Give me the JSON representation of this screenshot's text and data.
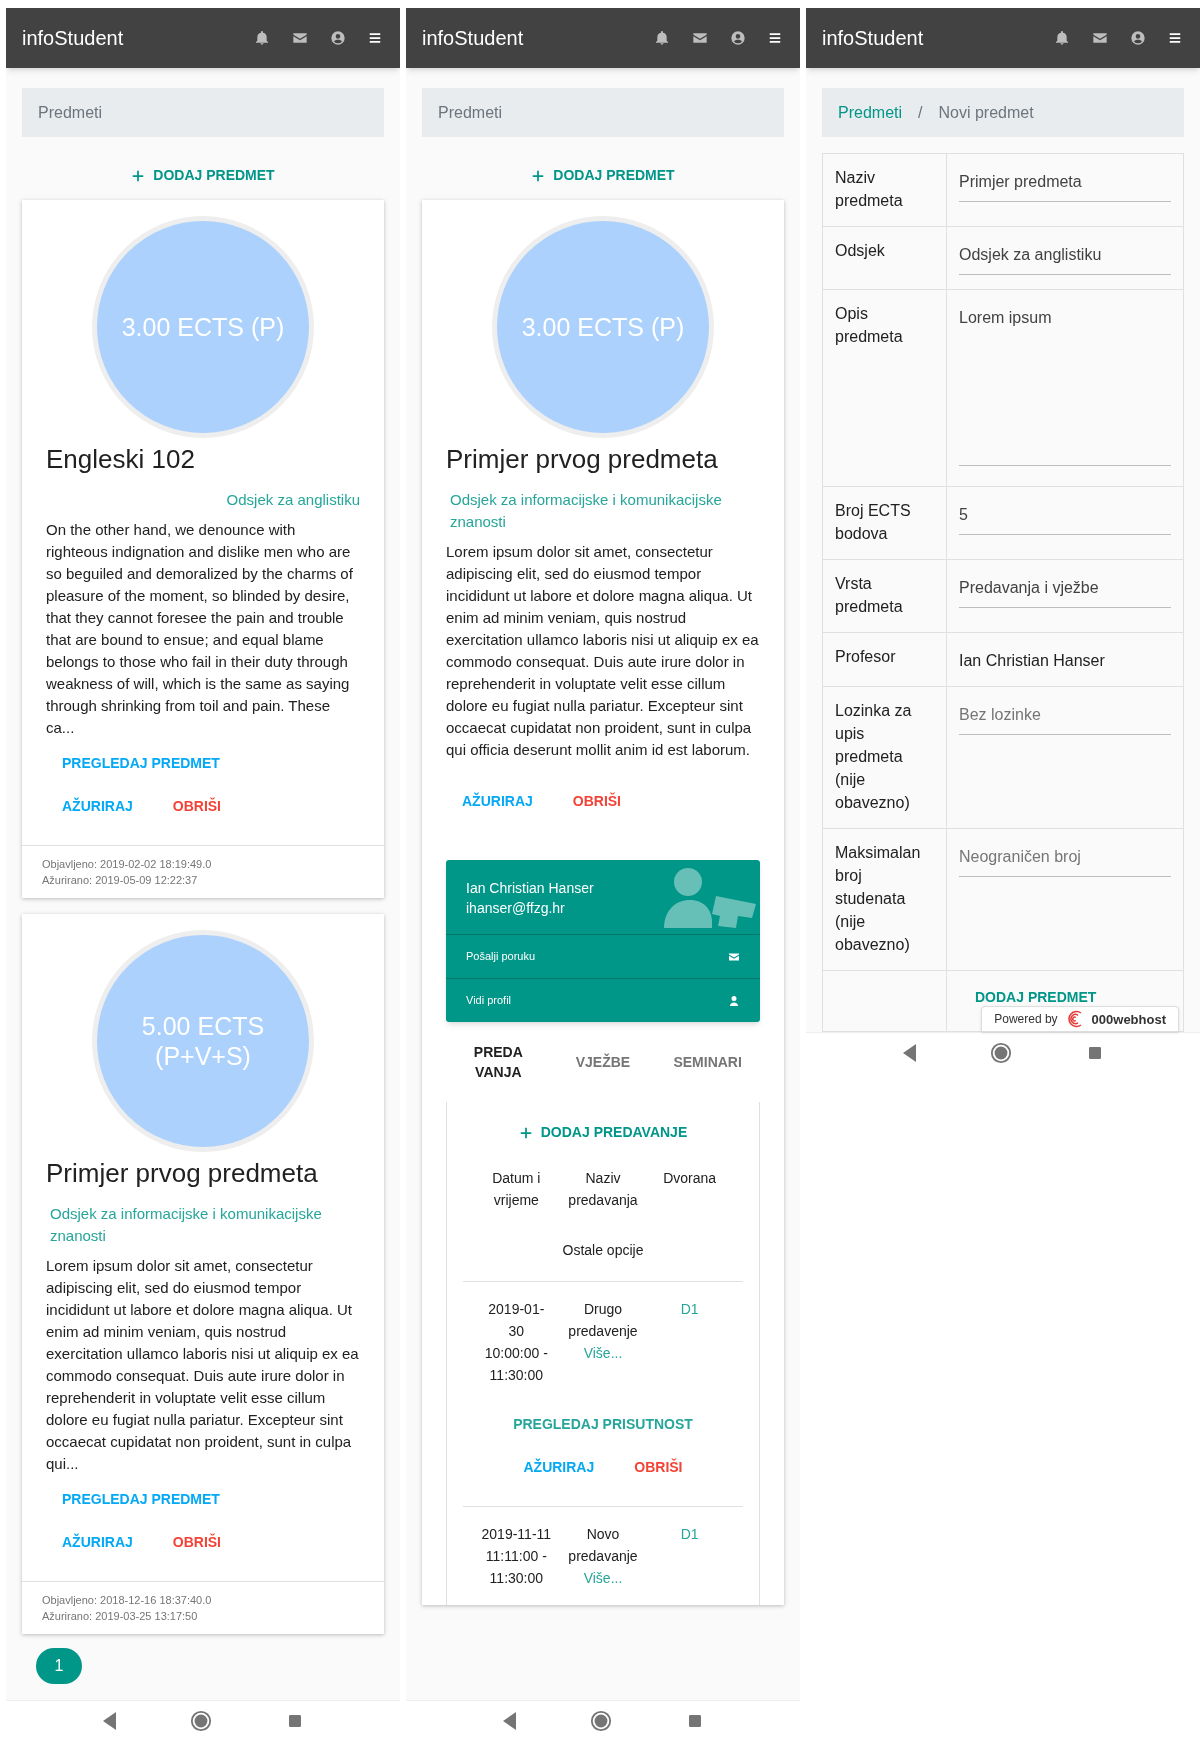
{
  "screens": [
    {
      "kind": "list",
      "app_title": "infoStudent",
      "breadcrumb": [
        {
          "label": "Predmeti",
          "link": false
        }
      ],
      "add_button": "DODAJ PREDMET",
      "courses": [
        {
          "ects": "3.00 ECTS (P)",
          "title": "Engleski 102",
          "department": "Odsjek za anglistiku",
          "department_right_aligned": true,
          "description": "On the other hand, we denounce with righteous indignation and dislike men who are so beguiled and demoralized by the charms of pleasure of the moment, so blinded by desire, that they cannot foresee the pain and trouble that are bound to ensue; and equal blame belongs to those who fail in their duty through weakness of will, which is the same as saying through shrinking from toil and pain. These ca...",
          "view_button": "PREGLEDAJ PREDMET",
          "update_button": "AŽURIRAJ",
          "delete_button": "OBRIŠI",
          "published": "Objavljeno: 2019-02-02 18:19:49.0",
          "updated": "Ažurirano: 2019-05-09 12:22:37"
        },
        {
          "ects": "5.00 ECTS (P+V+S)",
          "title": "Primjer prvog predmeta",
          "department": "Odsjek za informacijske i komunikacijske znanosti",
          "department_right_aligned": false,
          "description": "Lorem ipsum dolor sit amet, consectetur adipiscing elit, sed do eiusmod tempor incididunt ut labore et dolore magna aliqua. Ut enim ad minim veniam, quis nostrud exercitation ullamco laboris nisi ut aliquip ex ea commodo consequat. Duis aute irure dolor in reprehenderit in voluptate velit esse cillum dolore eu fugiat nulla pariatur. Excepteur sint occaecat cupidatat non proident, sunt in culpa qui...",
          "view_button": "PREGLEDAJ PREDMET",
          "update_button": "AŽURIRAJ",
          "delete_button": "OBRIŠI",
          "published": "Objavljeno: 2018-12-16 18:37:40.0",
          "updated": "Ažurirano: 2019-03-25 13:17:50"
        }
      ],
      "pagination": [
        {
          "label": "1",
          "selected": true
        }
      ]
    },
    {
      "kind": "detail",
      "app_title": "infoStudent",
      "breadcrumb": [
        {
          "label": "Predmeti",
          "link": false
        }
      ],
      "add_button": "DODAJ PREDMET",
      "course": {
        "ects": "3.00 ECTS (P)",
        "title": "Primjer prvog predmeta",
        "department": "Odsjek za informacijske i komunikacijske znanosti",
        "department_right_aligned": false,
        "description": "Lorem ipsum dolor sit amet, consectetur adipiscing elit, sed do eiusmod tempor incididunt ut labore et dolore magna aliqua. Ut enim ad minim veniam, quis nostrud exercitation ullamco laboris nisi ut aliquip ex ea commodo consequat. Duis aute irure dolor in reprehenderit in voluptate velit esse cillum dolore eu fugiat nulla pariatur. Excepteur sint occaecat cupidatat non proident, sunt in culpa qui officia deserunt mollit anim id est laborum.",
        "update_button": "AŽURIRAJ",
        "delete_button": "OBRIŠI"
      },
      "professor": {
        "name": "Ian Christian Hanser",
        "email": "ihanser@ffzg.hr",
        "actions": [
          {
            "label": "Pošalji poruku",
            "kind": "mail"
          },
          {
            "label": "Vidi profil",
            "kind": "user"
          }
        ]
      },
      "tabs": [
        {
          "label": "PREDAVANJA",
          "selected": true
        },
        {
          "label": "VJEŽBE",
          "selected": false
        },
        {
          "label": "SEMINARI",
          "selected": false
        }
      ],
      "add_lecture": "DODAJ PREDAVANJE",
      "columns": [
        "Datum i vrijeme",
        "Naziv predavanja",
        "Dvorana",
        "Ostale opcije"
      ],
      "lectures": [
        {
          "datetime": "2019-01-30 10:00:00 - 11:30:00",
          "name": "Drugo predavenje",
          "more": "Više...",
          "room": "D1",
          "attendance_button": "PREGLEDAJ PRISUTNOST",
          "update_button": "AŽURIRAJ",
          "delete_button": "OBRIŠI"
        },
        {
          "datetime": "2019-11-11 11:11:00 - 11:30:00",
          "name": "Novo predavanje",
          "more": "Više...",
          "room": "D1"
        }
      ]
    },
    {
      "kind": "form",
      "app_title": "infoStudent",
      "breadcrumb": [
        {
          "label": "Predmeti",
          "link": true
        },
        {
          "separator": "/",
          "label": "Novi predmet",
          "link": false
        }
      ],
      "fields": [
        {
          "label": "Naziv predmeta",
          "kind": "input",
          "value": "Primjer predmeta"
        },
        {
          "label": "Odsjek",
          "kind": "input",
          "value": "Odsjek za anglistiku"
        },
        {
          "label": "Opis predmeta",
          "kind": "textarea",
          "value": "Lorem ipsum"
        },
        {
          "label": "Broj ECTS bodova",
          "kind": "input",
          "value": "5"
        },
        {
          "label": "Vrsta predmeta",
          "kind": "input",
          "value": "Predavanja i vježbe"
        },
        {
          "label": "Profesor",
          "kind": "text",
          "value": "Ian Christian Hanser"
        },
        {
          "label": "Lozinka za upis predmeta (nije obavezno)",
          "kind": "input",
          "placeholder": "Bez lozinke"
        },
        {
          "label": "Maksimalan broj studenata (nije obavezno)",
          "kind": "input",
          "placeholder": "Neograničen broj"
        }
      ],
      "submit_button": "DODAJ PREDMET",
      "host_badge": {
        "prefix": "Powered by",
        "brand": "000webhost"
      }
    }
  ]
}
